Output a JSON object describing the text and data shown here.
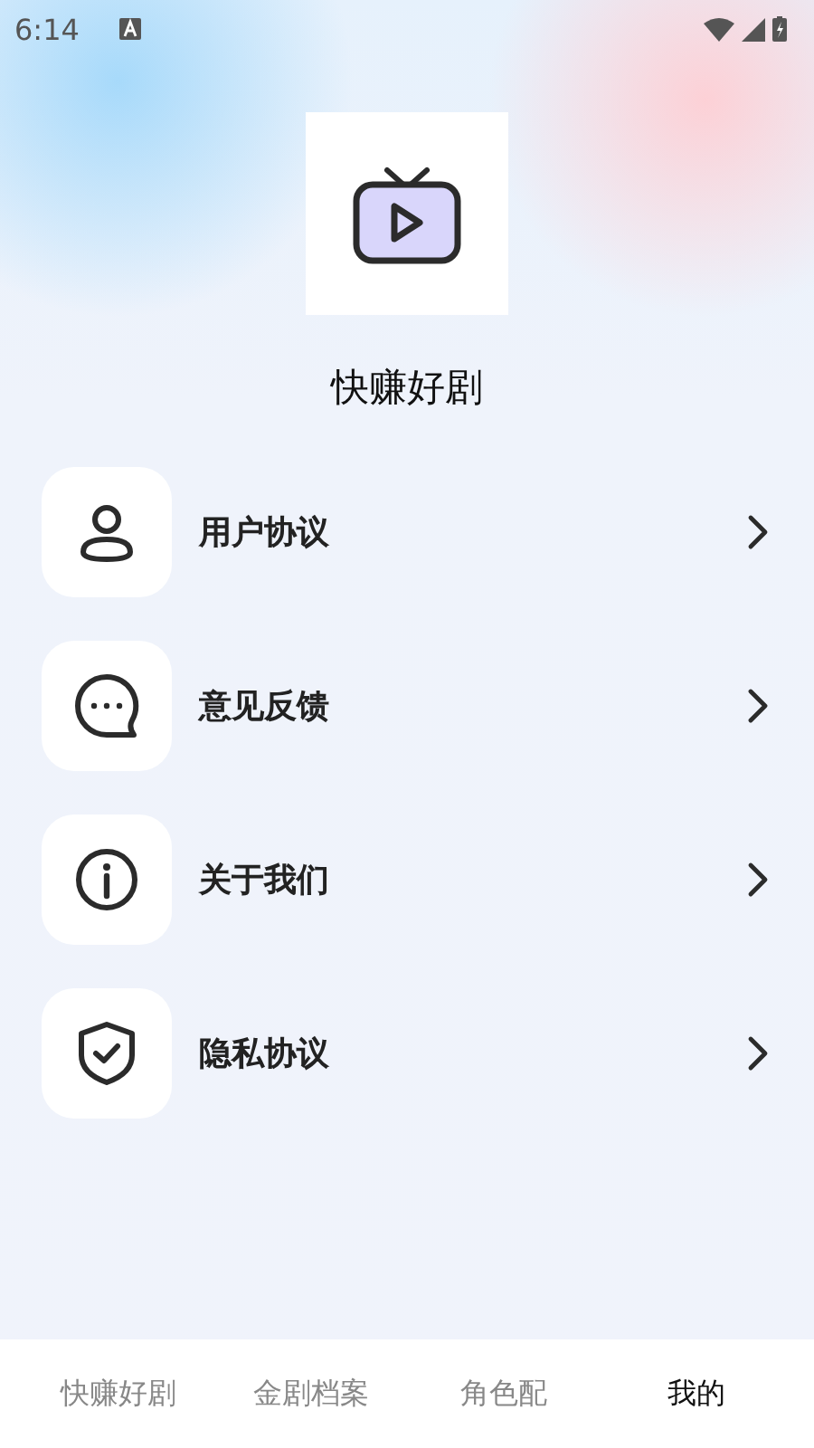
{
  "status_bar": {
    "time": "6:14"
  },
  "app": {
    "name": "快赚好剧"
  },
  "menu": [
    {
      "label": "用户协议",
      "kind": "user"
    },
    {
      "label": "意见反馈",
      "kind": "chat"
    },
    {
      "label": "关于我们",
      "kind": "info"
    },
    {
      "label": "隐私协议",
      "kind": "shield"
    }
  ],
  "tabs": [
    {
      "label": "快赚好剧",
      "selected": false
    },
    {
      "label": "金剧档案",
      "selected": false
    },
    {
      "label": "角色配",
      "selected": false
    },
    {
      "label": "我的",
      "selected": true
    }
  ]
}
